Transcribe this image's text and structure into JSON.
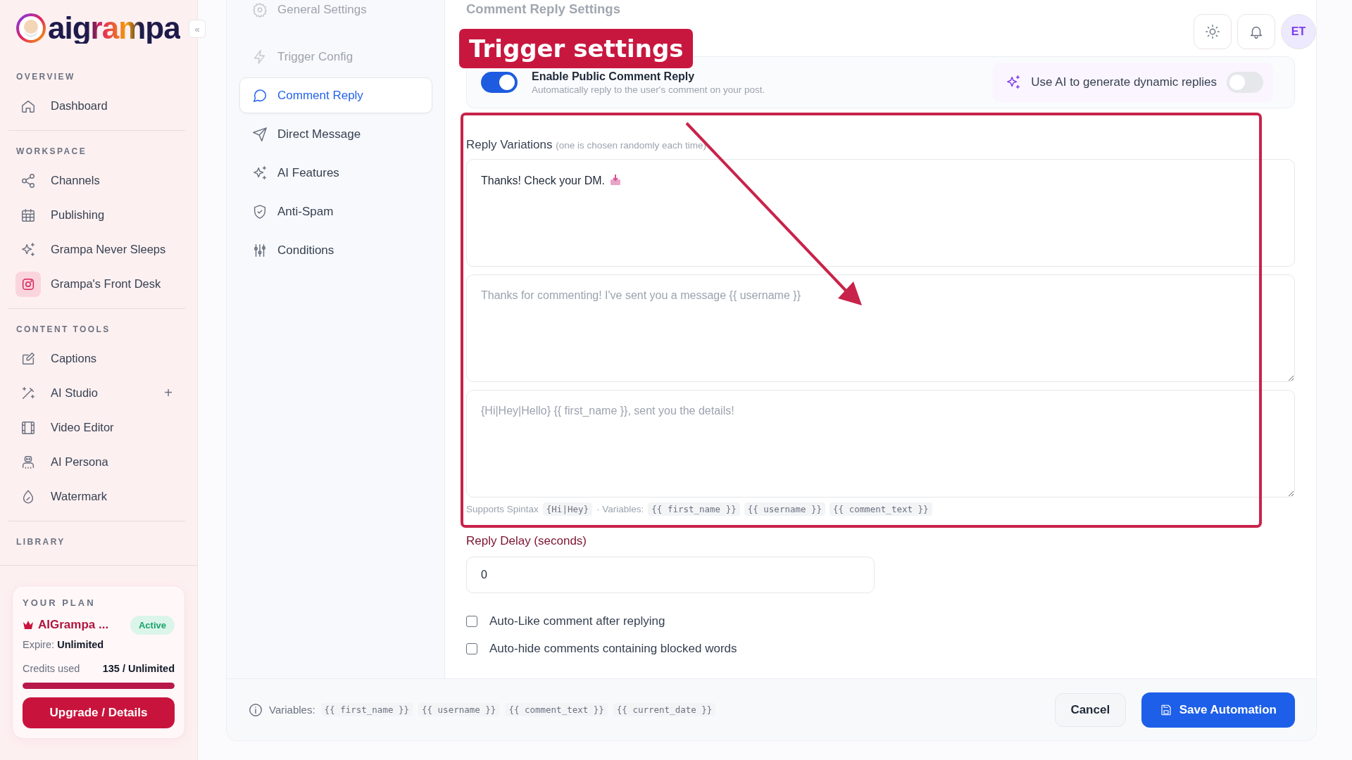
{
  "logo": {
    "text": "aigrampa",
    "collapse": "«"
  },
  "sidebar": {
    "sections": [
      {
        "label": "OVERVIEW",
        "items": [
          {
            "label": "Dashboard"
          }
        ]
      },
      {
        "label": "WORKSPACE",
        "items": [
          {
            "label": "Channels"
          },
          {
            "label": "Publishing"
          },
          {
            "label": "Grampa Never Sleeps"
          },
          {
            "label": "Grampa's Front Desk"
          }
        ]
      },
      {
        "label": "CONTENT TOOLS",
        "items": [
          {
            "label": "Captions"
          },
          {
            "label": "AI Studio",
            "action": "+"
          },
          {
            "label": "Video Editor"
          },
          {
            "label": "AI Persona"
          },
          {
            "label": "Watermark"
          }
        ]
      },
      {
        "label": "LIBRARY"
      }
    ]
  },
  "plan": {
    "heading": "YOUR PLAN",
    "name": "AIGrampa ...",
    "status": "Active",
    "expire_label": "Expire:",
    "expire_value": "Unlimited",
    "credits_label": "Credits used",
    "credits_value": "135 / Unlimited",
    "level": 1,
    "button": "Upgrade / Details"
  },
  "settings_nav": [
    {
      "label": "General Settings",
      "selected": false,
      "dimmed": true
    },
    {
      "label": "Trigger Config",
      "selected": false,
      "dimmed": true
    },
    {
      "label": "Comment Reply",
      "selected": true,
      "dimmed": false
    },
    {
      "label": "Direct Message",
      "selected": false,
      "dimmed": false
    },
    {
      "label": "AI Features",
      "selected": false,
      "dimmed": false
    },
    {
      "label": "Anti-Spam",
      "selected": false,
      "dimmed": false
    },
    {
      "label": "Conditions",
      "selected": false,
      "dimmed": false
    }
  ],
  "header": {
    "title": "Comment Reply Settings",
    "avatar": "ET"
  },
  "public_reply": {
    "title": "Enable Public Comment Reply",
    "description": "Automatically reply to the user's comment on your post.",
    "on": true
  },
  "ai_replies": {
    "label": "Use AI to generate dynamic replies",
    "on": false
  },
  "reply_variations": {
    "label": "Reply Variations",
    "hint": "(one is chosen randomly each time)",
    "fields": [
      {
        "kind": "value",
        "text": "Thanks! Check your DM."
      },
      {
        "kind": "placeholder",
        "placeholder": "Thanks for commenting! I've sent you a message {{ username }}"
      },
      {
        "kind": "placeholder",
        "placeholder": "{Hi|Hey|Hello} {{ first_name }}, sent you the details!"
      }
    ],
    "help_prefix": "Supports Spintax",
    "spintax": "{Hi|Hey}",
    "help_variables": "· Variables:",
    "variables": [
      "{{ first_name }}",
      "{{ username }}",
      "{{ comment_text }}"
    ]
  },
  "reply_delay": {
    "label": "Reply Delay (seconds)",
    "value": "0"
  },
  "options": [
    {
      "label": "Auto-Like comment after replying",
      "checked": false
    },
    {
      "label": "Auto-hide comments containing blocked words",
      "checked": false
    }
  ],
  "footer": {
    "variables_label": "Variables:",
    "variables": [
      "{{ first_name }}",
      "{{ username }}",
      "{{ comment_text }}",
      "{{ current_date }}"
    ],
    "cancel": "Cancel",
    "save": "Save Automation"
  },
  "annotation": {
    "label": "Trigger settings"
  }
}
